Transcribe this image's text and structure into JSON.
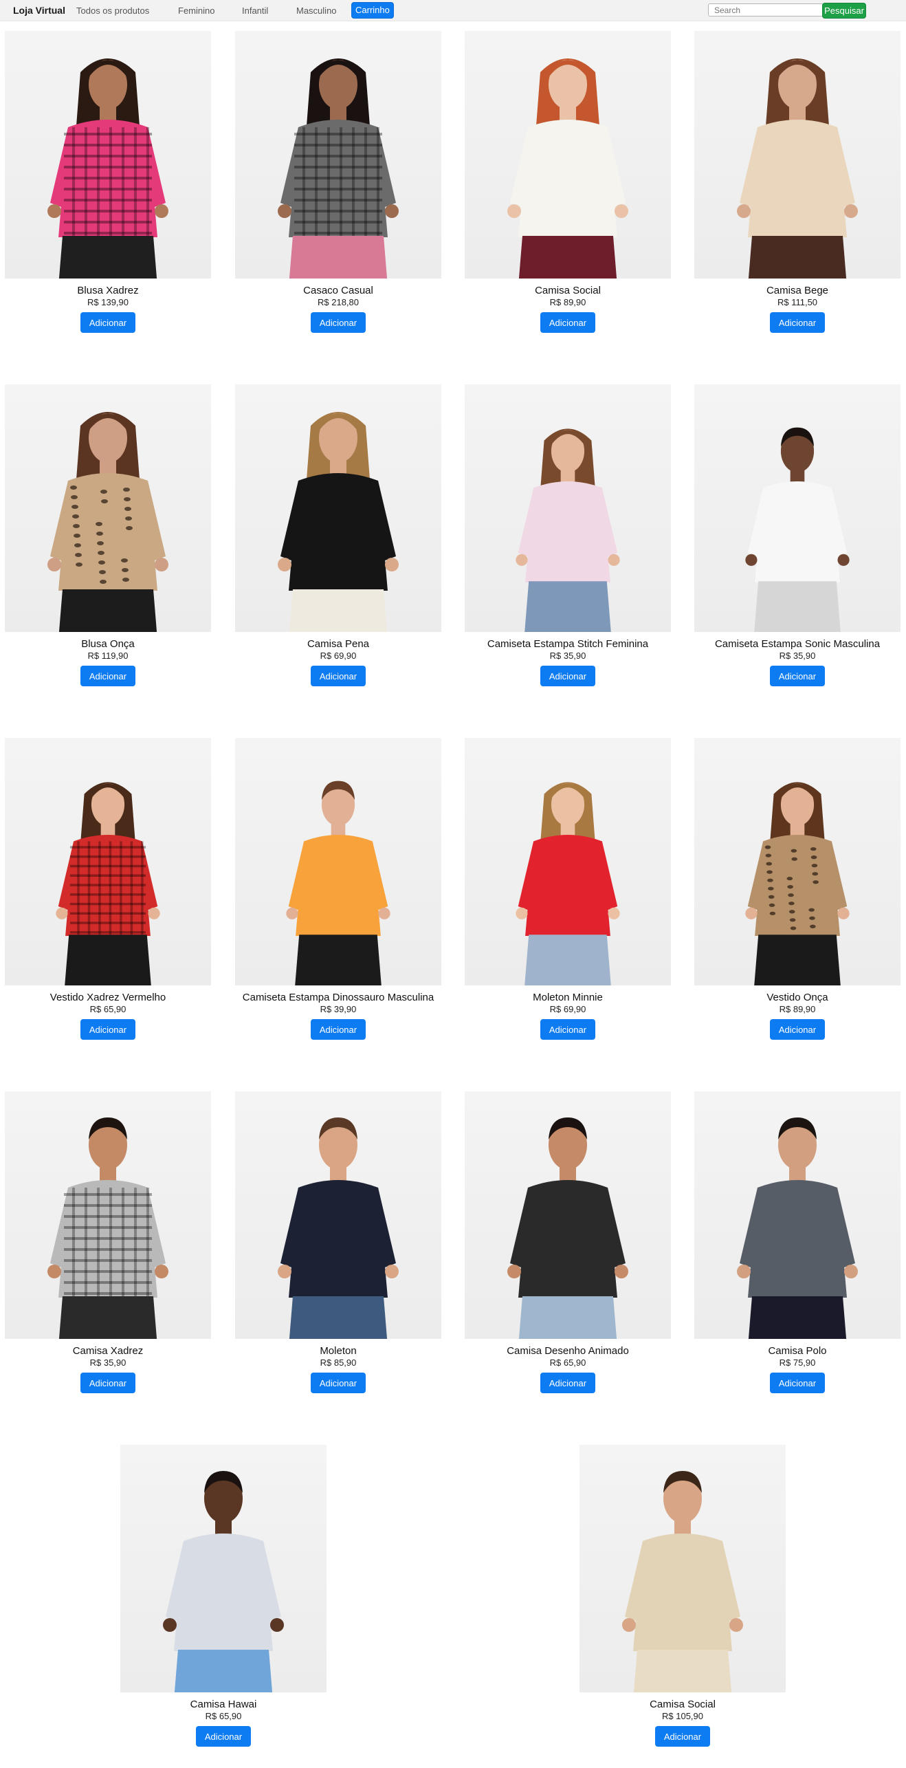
{
  "navbar": {
    "brand": "Loja Virtual",
    "links": [
      "Todos os produtos",
      "Feminino",
      "Infantil",
      "Masculino"
    ],
    "cart_label": "Carrinho",
    "search_placeholder": "Search",
    "search_button": "Pesquisar"
  },
  "colors": {
    "primary": "#0d7cf2",
    "search_button": "#1ea046",
    "navbar_bg": "#f2f2f2"
  },
  "add_label": "Adicionar",
  "products": [
    {
      "name": "Blusa Xadrez",
      "price": "R$ 139,90",
      "image": "woman-pink-plaid-shirt",
      "top": "#e53a7a",
      "bottom": "#1f1f1f",
      "skin": "#b07a5a",
      "hair": "#2a1a12"
    },
    {
      "name": "Casaco Casual",
      "price": "R$ 218,80",
      "image": "woman-plaid-jacket",
      "top": "#6b6b6b",
      "bottom": "#d87a96",
      "skin": "#9c6a4e",
      "hair": "#1a1210"
    },
    {
      "name": "Camisa Social",
      "price": "R$ 89,90",
      "image": "woman-white-top",
      "top": "#f6f4ee",
      "bottom": "#6e1d2a",
      "skin": "#e9c2a8",
      "hair": "#c4572e"
    },
    {
      "name": "Camisa Bege",
      "price": "R$ 111,50",
      "image": "woman-beige-top",
      "top": "#ead6bc",
      "bottom": "#4a2b22",
      "skin": "#d7a98c",
      "hair": "#6a3e26"
    },
    {
      "name": "Blusa Onça",
      "price": "R$ 119,90",
      "image": "woman-leopard-blouse",
      "top": "#c9a883",
      "bottom": "#1c1c1c",
      "skin": "#cf9f85",
      "hair": "#5c3422"
    },
    {
      "name": "Camisa Pena",
      "price": "R$ 69,90",
      "image": "woman-black-tshirt",
      "top": "#151515",
      "bottom": "#eeeadf",
      "skin": "#d9a98a",
      "hair": "#a67a45"
    },
    {
      "name": "Camiseta Estampa Stitch Feminina",
      "price": "R$ 35,90",
      "image": "girl-stitch-tshirt",
      "top": "#f0d8e4",
      "bottom": "#7d98b8",
      "skin": "#e6b89b",
      "hair": "#7a4a2c"
    },
    {
      "name": "Camiseta Estampa Sonic Masculina",
      "price": "R$ 35,90",
      "image": "boy-sonic-tshirt",
      "top": "#f7f7f7",
      "bottom": "#d6d6d6",
      "skin": "#6e4530",
      "hair": "#1a120e"
    },
    {
      "name": "Vestido Xadrez Vermelho",
      "price": "R$ 65,90",
      "image": "girl-red-plaid-dress",
      "top": "#d32a2a",
      "bottom": "#1a1a1a",
      "skin": "#e5b496",
      "hair": "#4a2a18"
    },
    {
      "name": "Camiseta Estampa Dinossauro Masculina",
      "price": "R$ 39,90",
      "image": "boy-orange-dino-tshirt",
      "top": "#f7a23a",
      "bottom": "#1b1b1b",
      "skin": "#e2b095",
      "hair": "#6a4128"
    },
    {
      "name": "Moleton Minnie",
      "price": "R$ 69,90",
      "image": "girl-red-minnie-hoodie",
      "top": "#e2232e",
      "bottom": "#9fb4cc",
      "skin": "#ecc0a2",
      "hair": "#a97942"
    },
    {
      "name": "Vestido Onça",
      "price": "R$ 89,90",
      "image": "girl-leopard-dress",
      "top": "#b69069",
      "bottom": "#1a1a1a",
      "skin": "#e3b294",
      "hair": "#5e361e"
    },
    {
      "name": "Camisa Xadrez",
      "price": "R$ 35,90",
      "image": "man-grey-plaid-shirt",
      "top": "#b9b9b9",
      "bottom": "#2a2a2a",
      "skin": "#c48a66",
      "hair": "#1d1410"
    },
    {
      "name": "Moleton",
      "price": "R$ 85,90",
      "image": "man-navy-sweater",
      "top": "#1c2233",
      "bottom": "#3e5a7e",
      "skin": "#d9a584",
      "hair": "#5a3a26"
    },
    {
      "name": "Camisa Desenho Animado",
      "price": "R$ 65,90",
      "image": "man-cartoon-print-shirt",
      "top": "#2a2a2a",
      "bottom": "#9fb6cf",
      "skin": "#c58a67",
      "hair": "#1a1210"
    },
    {
      "name": "Camisa Polo",
      "price": "R$ 75,90",
      "image": "man-grey-polo",
      "top": "#565d66",
      "bottom": "#1a1a2a",
      "skin": "#d2a080",
      "hair": "#1c1410"
    },
    {
      "name": "Camisa Hawai",
      "price": "R$ 65,90",
      "image": "man-floral-shirt",
      "top": "#d8dde5",
      "bottom": "#6fa5d8",
      "skin": "#5a3624",
      "hair": "#1a1210"
    },
    {
      "name": "Camisa Social",
      "price": "R$ 105,90",
      "image": "man-beige-shirt",
      "top": "#e2d3b6",
      "bottom": "#e9dcc4",
      "skin": "#d8a586",
      "hair": "#3c2618"
    }
  ]
}
